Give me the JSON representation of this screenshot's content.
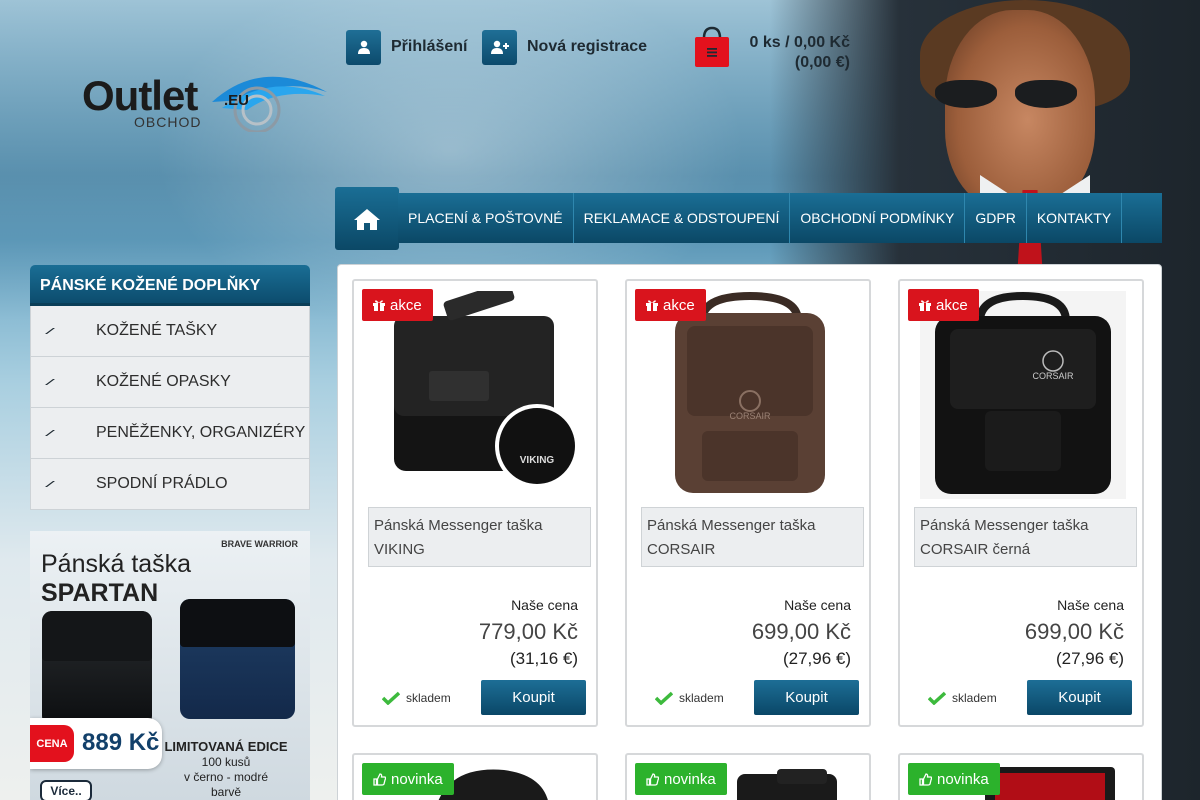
{
  "header": {
    "login_label": "Přihlášení",
    "register_label": "Nová registrace",
    "cart_count": "0 ks / 0,00 Kč",
    "cart_eur": "(0,00 €)"
  },
  "logo": {
    "word": "Outlet",
    "suffix": ".EU",
    "sub": "OBCHOD"
  },
  "nav": [
    "PLACENÍ & POŠTOVNÉ",
    "REKLAMACE & ODSTOUPENÍ",
    "OBCHODNÍ PODMÍNKY",
    "GDPR",
    "KONTAKTY"
  ],
  "sidebar": {
    "title": "PÁNSKÉ KOŽENÉ DOPLŇKY",
    "items": [
      "KOŽENÉ TAŠKY",
      "KOŽENÉ OPASKY",
      "PENĚŽENKY, ORGANIZÉRY",
      "SPODNÍ PRÁDLO"
    ]
  },
  "banner": {
    "subtitle": "BRAVE WARRIOR",
    "title_prefix": "Pánská taška",
    "title_bold": "SPARTAN",
    "price_tag": "CENA",
    "price": "889 Kč",
    "limited_1": "LIMITOVANÁ EDICE",
    "limited_2": "100 kusů",
    "limited_3": "v černo - modré",
    "limited_4": "barvě",
    "more": "Více.."
  },
  "products": [
    {
      "tag": "akce",
      "name": "Pánská Messenger taška VIKING",
      "price_label": "Naše cena",
      "price": "779,00 Kč",
      "price_eur": "(31,16 €)",
      "stock": "skladem",
      "buy": "Koupit",
      "brand_mark": "VIKING"
    },
    {
      "tag": "akce",
      "name": "Pánská Messenger taška CORSAIR",
      "price_label": "Naše cena",
      "price": "699,00 Kč",
      "price_eur": "(27,96 €)",
      "stock": "skladem",
      "buy": "Koupit",
      "brand_mark": "CORSAIR"
    },
    {
      "tag": "akce",
      "name": "Pánská Messenger taška CORSAIR černá",
      "price_label": "Naše cena",
      "price": "699,00 Kč",
      "price_eur": "(27,96 €)",
      "stock": "skladem",
      "buy": "Koupit",
      "brand_mark": "CORSAIR"
    }
  ],
  "products_row2": [
    {
      "tag": "novinka"
    },
    {
      "tag": "novinka"
    },
    {
      "tag": "novinka"
    }
  ],
  "colors": {
    "accent": "#0c4c6d",
    "sale": "#d9141d",
    "new": "#2cb22c",
    "stock_check": "#3dba3d"
  }
}
